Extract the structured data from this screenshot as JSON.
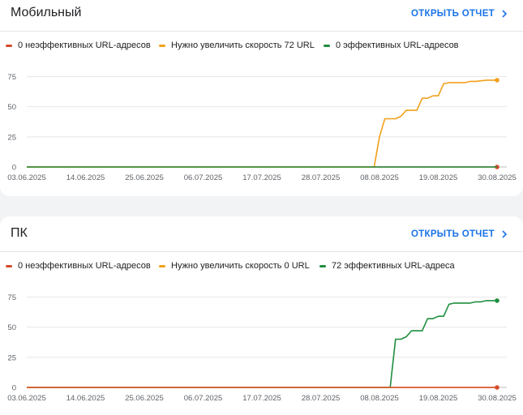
{
  "colors": {
    "poor": "#d44c2b",
    "needs_improvement": "#f2a01c",
    "good": "#1e8e3e",
    "accent": "#1a73e8"
  },
  "cards": [
    {
      "title": "Мобильный",
      "open_report_label": "ОТКРЫТЬ ОТЧЕТ",
      "open_report_icon": "chevron-right-icon",
      "legend": [
        {
          "label": "0 неэффективных URL-адресов",
          "color_key": "poor"
        },
        {
          "label": "Нужно увеличить скорость 72 URL",
          "color_key": "needs_improvement"
        },
        {
          "label": "0 эффективных URL-адресов",
          "color_key": "good"
        }
      ]
    },
    {
      "title": "ПК",
      "open_report_label": "ОТКРЫТЬ ОТЧЕТ",
      "open_report_icon": "chevron-right-icon",
      "legend": [
        {
          "label": "0 неэффективных URL-адресов",
          "color_key": "poor"
        },
        {
          "label": "Нужно увеличить скорость 0 URL",
          "color_key": "needs_improvement"
        },
        {
          "label": "72 эффективных URL-адреса",
          "color_key": "good"
        }
      ]
    }
  ],
  "chart_data": [
    {
      "type": "line",
      "x_tick_labels": [
        "03.06.2025",
        "14.06.2025",
        "25.06.2025",
        "06.07.2025",
        "17.07.2025",
        "28.07.2025",
        "08.08.2025",
        "19.08.2025",
        "30.08.2025"
      ],
      "y_ticks": [
        0,
        25,
        50,
        75
      ],
      "ylim": [
        0,
        80
      ],
      "xlim_days": [
        0,
        88
      ],
      "grid": true,
      "series": [
        {
          "name": "0 неэффективных URL-адресов",
          "color_key": "poor",
          "end_marker": true,
          "points": [
            [
              0,
              0
            ],
            [
              88,
              0
            ]
          ]
        },
        {
          "name": "Нужно увеличить скорость 72 URL",
          "color_key": "needs_improvement",
          "end_marker": true,
          "points": [
            [
              0,
              0
            ],
            [
              65,
              0
            ],
            [
              66,
              25
            ],
            [
              67,
              40
            ],
            [
              69,
              40
            ],
            [
              70,
              42
            ],
            [
              71,
              47
            ],
            [
              73,
              47
            ],
            [
              74,
              57
            ],
            [
              75,
              57
            ],
            [
              76,
              59
            ],
            [
              77,
              59
            ],
            [
              78,
              69
            ],
            [
              79,
              70
            ],
            [
              81,
              70
            ],
            [
              82,
              70
            ],
            [
              83,
              71
            ],
            [
              84,
              71
            ],
            [
              86,
              72
            ],
            [
              88,
              72
            ]
          ]
        },
        {
          "name": "0 эффективных URL-адресов",
          "color_key": "good",
          "end_marker": false,
          "points": [
            [
              0,
              0
            ],
            [
              88,
              0
            ]
          ]
        }
      ]
    },
    {
      "type": "line",
      "x_tick_labels": [
        "03.06.2025",
        "14.06.2025",
        "25.06.2025",
        "06.07.2025",
        "17.07.2025",
        "28.07.2025",
        "08.08.2025",
        "19.08.2025",
        "30.08.2025"
      ],
      "y_ticks": [
        0,
        25,
        50,
        75
      ],
      "ylim": [
        0,
        80
      ],
      "xlim_days": [
        0,
        88
      ],
      "grid": true,
      "series": [
        {
          "name": "72 эффективных URL-адреса",
          "color_key": "good",
          "end_marker": true,
          "points": [
            [
              0,
              0
            ],
            [
              68,
              0
            ],
            [
              69,
              40
            ],
            [
              70,
              40
            ],
            [
              71,
              42
            ],
            [
              72,
              47
            ],
            [
              74,
              47
            ],
            [
              75,
              57
            ],
            [
              76,
              57
            ],
            [
              77,
              59
            ],
            [
              78,
              59
            ],
            [
              79,
              69
            ],
            [
              80,
              70
            ],
            [
              82,
              70
            ],
            [
              83,
              70
            ],
            [
              84,
              71
            ],
            [
              85,
              71
            ],
            [
              86,
              72
            ],
            [
              88,
              72
            ]
          ]
        },
        {
          "name": "Нужно увеличить скорость 0 URL",
          "color_key": "needs_improvement",
          "end_marker": false,
          "points": [
            [
              0,
              0
            ],
            [
              88,
              0
            ]
          ]
        },
        {
          "name": "0 неэффективных URL-адресов",
          "color_key": "poor",
          "end_marker": true,
          "points": [
            [
              0,
              0
            ],
            [
              88,
              0
            ]
          ]
        }
      ]
    }
  ]
}
